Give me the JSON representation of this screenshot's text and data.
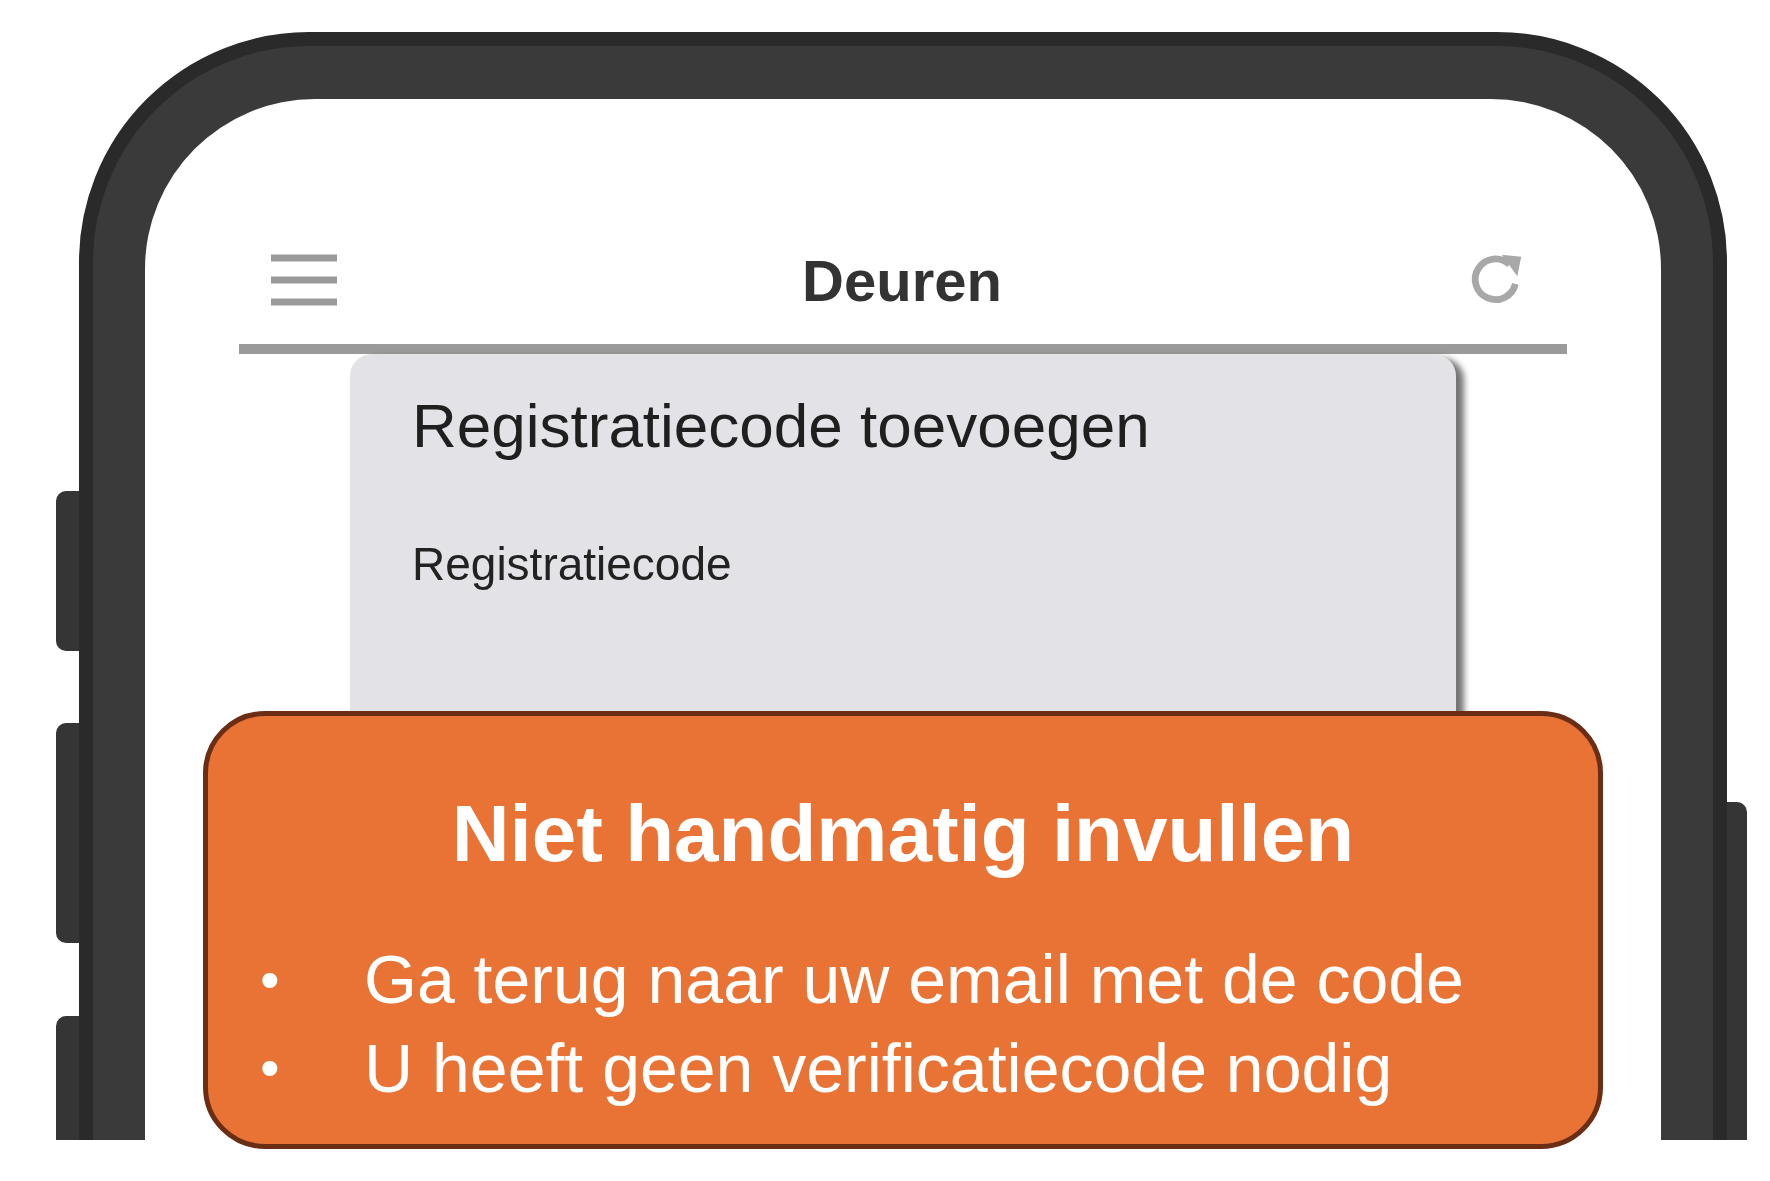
{
  "app_bar": {
    "title": "Deuren"
  },
  "dialog": {
    "title": "Registratiecode toevoegen",
    "field_label": "Registratiecode"
  },
  "callout": {
    "title": "Niet handmatig invullen",
    "bullets": [
      {
        "marker": "•",
        "text": "Ga terug naar uw email met de code"
      },
      {
        "marker": "•",
        "text": "U heeft geen verificatiecode nodig"
      }
    ]
  }
}
